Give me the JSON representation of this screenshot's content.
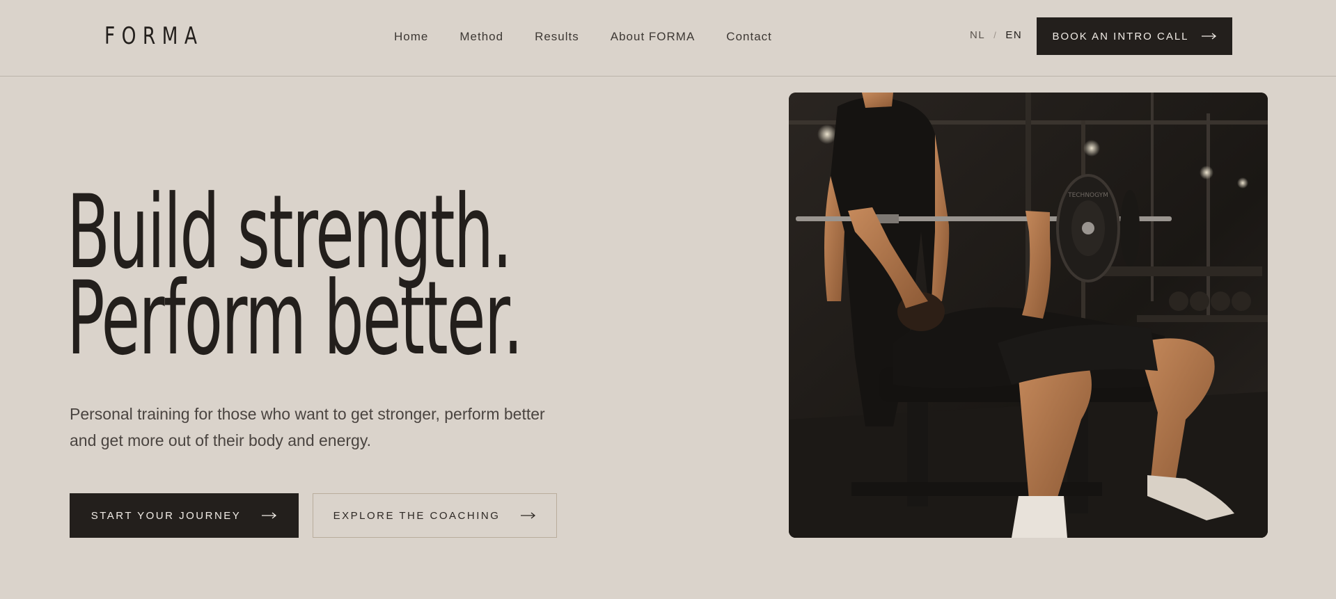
{
  "header": {
    "logo": "FORMA",
    "nav": [
      {
        "label": "Home"
      },
      {
        "label": "Method"
      },
      {
        "label": "Results"
      },
      {
        "label": "About FORMA"
      },
      {
        "label": "Contact"
      }
    ],
    "lang": {
      "nl": "NL",
      "separator": "/",
      "en": "EN",
      "active": "EN"
    },
    "cta_label": "BOOK AN INTRO CALL",
    "cta_icon": "arrow-right-icon"
  },
  "hero": {
    "headline_line1": "Build strength.",
    "headline_line2": "Perform better.",
    "subtitle": "Personal training for those who want to get stronger, perform better and get more out of their body and energy.",
    "primary_button": "START YOUR JOURNEY",
    "secondary_button": "EXPLORE THE COACHING",
    "image": {
      "type": "photo",
      "subject": "trainer-spotting-bench-press"
    },
    "plate_text": "TECHNOGYM"
  },
  "colors": {
    "background": "#dad3cb",
    "text": "#231f1c",
    "button_dark": "#231f1c",
    "button_text": "#f1ece6",
    "outline": "#b9ad9c"
  }
}
